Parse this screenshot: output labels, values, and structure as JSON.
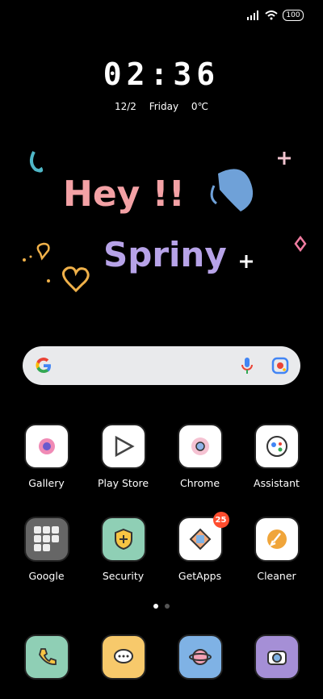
{
  "status_bar": {
    "battery": "100"
  },
  "lockscreen": {
    "time": "02:36",
    "date": "12/2",
    "weekday": "Friday",
    "temperature": "0℃"
  },
  "art": {
    "line1": "Hey !!",
    "line2": "Spriny"
  },
  "row1": [
    {
      "label": "Gallery",
      "icon": "gallery-icon"
    },
    {
      "label": "Play Store",
      "icon": "play-store-icon"
    },
    {
      "label": "Chrome",
      "icon": "chrome-icon"
    },
    {
      "label": "Assistant",
      "icon": "assistant-icon"
    }
  ],
  "row2": [
    {
      "label": "Google",
      "icon": "google-folder-icon"
    },
    {
      "label": "Security",
      "icon": "security-icon"
    },
    {
      "label": "GetApps",
      "icon": "getapps-icon",
      "badge": "25"
    },
    {
      "label": "Cleaner",
      "icon": "cleaner-icon"
    }
  ],
  "dock": [
    {
      "icon": "phone-icon"
    },
    {
      "icon": "messages-icon"
    },
    {
      "icon": "browser-icon"
    },
    {
      "icon": "camera-icon"
    }
  ]
}
